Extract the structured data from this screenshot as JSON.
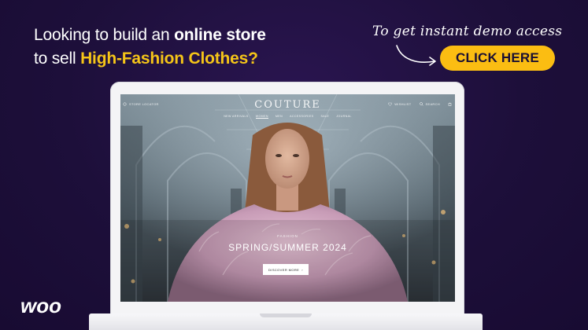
{
  "ad": {
    "headline_line1_pre": "Looking to build an ",
    "headline_line1_bold": "online store",
    "headline_line2_pre": "to sell ",
    "headline_line2_accent": "High-Fashion Clothes?",
    "handwritten_note": "To get instant demo access",
    "cta_label": "CLICK HERE",
    "logo_text": "woo",
    "colors": {
      "background": "#1d0f3a",
      "accent": "#f5c518",
      "cta": "#fbbd12"
    }
  },
  "store": {
    "store_locator": "STORE LOCATOR",
    "brand": "COUTURE",
    "wishlist": "WISHLIST",
    "search": "SEARCH",
    "menu": [
      "NEW ARRIVALS",
      "WOMEN",
      "MEN",
      "ACCESSORIES",
      "SALE",
      "JOURNAL"
    ],
    "active_menu_index": 1,
    "hero": {
      "eyebrow": "FASHION",
      "title": "SPRING/SUMMER 2024",
      "button_label": "DISCOVER MORE"
    }
  }
}
